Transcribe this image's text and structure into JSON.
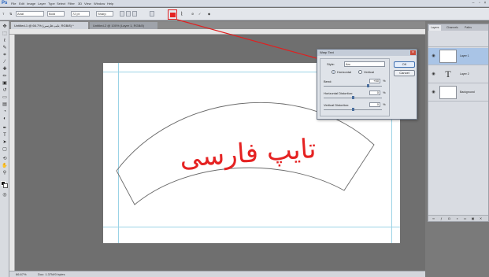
{
  "app": {
    "logo": "Ps",
    "menu": [
      "File",
      "Edit",
      "Image",
      "Layer",
      "Type",
      "Select",
      "Filter",
      "3D",
      "View",
      "Window",
      "Help"
    ],
    "window_controls": [
      "–",
      "▫",
      "×"
    ]
  },
  "options_bar": {
    "font_family": "Arial",
    "font_style": "Bold",
    "font_size": "72 pt",
    "anti_alias": "Sharp",
    "color": "#e52222"
  },
  "tabs": [
    {
      "label": "Untitled-1 @ 66.7% (تایپ فارسی, RGB/8) *",
      "active": true
    },
    {
      "label": "Untitled-2 @ 100% (Layer 1, RGB/8)",
      "active": false
    }
  ],
  "canvas": {
    "text": "تایپ فارسی",
    "text_color": "#e52222",
    "background": "#ffffff"
  },
  "status": {
    "zoom": "66.67%",
    "doc": "Doc: 1.37M/0 bytes"
  },
  "layers_panel": {
    "tabs": [
      "Layers",
      "Channels",
      "Paths"
    ],
    "layers": [
      {
        "name": "Layer 1",
        "selected": true,
        "kind": "pixel"
      },
      {
        "name": "Layer 2",
        "selected": false,
        "kind": "text"
      },
      {
        "name": "Background",
        "selected": false,
        "kind": "pixel"
      }
    ]
  },
  "warp_dialog": {
    "title": "Warp Text",
    "style_label": "Style:",
    "style_value": "Arc",
    "horizontal_label": "Horizontal",
    "vertical_label": "Vertical",
    "bend_label": "Bend:",
    "bend_value": "+50",
    "h_distortion_label": "Horizontal Distortion:",
    "h_distortion_value": "0",
    "v_distortion_label": "Vertical Distortion:",
    "v_distortion_value": "0",
    "pct": "%",
    "ok_label": "OK",
    "cancel_label": "Cancel"
  }
}
